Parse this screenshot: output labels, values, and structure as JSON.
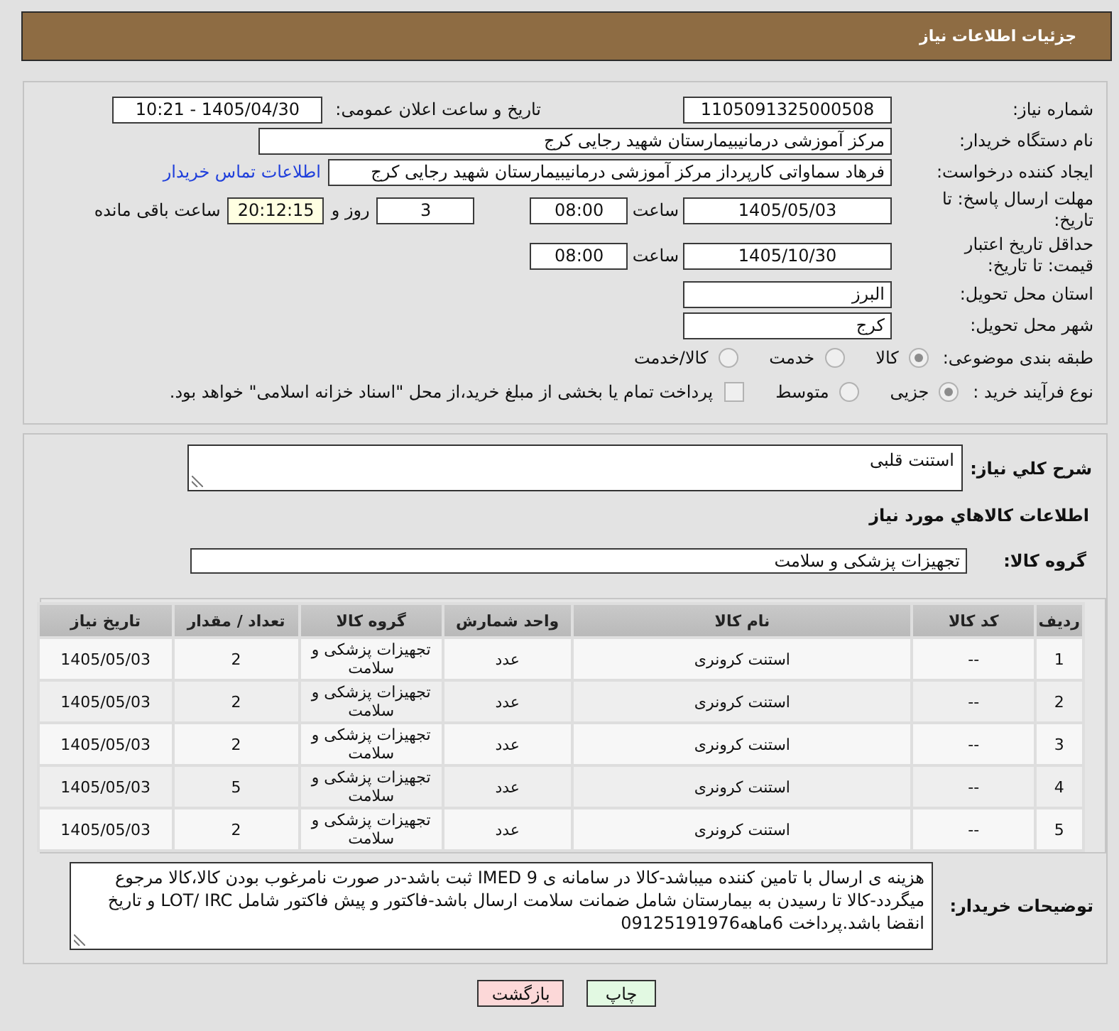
{
  "header": {
    "title": "جزئیات اطلاعات نیاز"
  },
  "form": {
    "need_number": {
      "label": "شماره نیاز:",
      "value": "1105091325000508"
    },
    "announce": {
      "label": "تاریخ و ساعت اعلان عمومی:",
      "value": "1405/04/30 - 10:21"
    },
    "buyer_org": {
      "label": "نام دستگاه خریدار:",
      "value": "مرکز آموزشی درمانیبیمارستان شهید رجایی کرج"
    },
    "requester": {
      "label": "ایجاد کننده درخواست:",
      "value": "فرهاد سماواتی کارپرداز مرکز آموزشی درمانیبیمارستان شهید رجایی کرج",
      "link": "اطلاعات تماس خریدار"
    },
    "reply_deadline": {
      "label": "مهلت ارسال پاسخ: تا تاریخ:",
      "date": "1405/05/03",
      "time_label": "ساعت",
      "time": "08:00",
      "days": "3",
      "days_label": "روز و",
      "remaining": "20:12:15",
      "remaining_label": "ساعت باقی مانده"
    },
    "price_validity": {
      "label": "حداقل تاریخ اعتبار قیمت: تا تاریخ:",
      "date": "1405/10/30",
      "time_label": "ساعت",
      "time": "08:00"
    },
    "province": {
      "label": "استان محل تحویل:",
      "value": "البرز"
    },
    "city": {
      "label": "شهر محل تحویل:",
      "value": "کرج"
    },
    "category": {
      "label": "طبقه بندی موضوعی:",
      "options": [
        {
          "label": "کالا",
          "selected": true
        },
        {
          "label": "خدمت",
          "selected": false
        },
        {
          "label": "کالا/خدمت",
          "selected": false
        }
      ]
    },
    "process": {
      "label": "نوع فرآیند خرید :",
      "options": [
        {
          "label": "جزیی",
          "selected": true
        },
        {
          "label": "متوسط",
          "selected": false
        }
      ],
      "treasury": {
        "label": "پرداخت تمام یا بخشی از مبلغ خرید،از محل \"اسناد خزانه اسلامی\" خواهد بود.",
        "checked": false
      }
    }
  },
  "need": {
    "description_label": "شرح کلي نياز:",
    "description": "استنت قلبی",
    "items_title": "اطلاعات كالاهاي مورد نياز",
    "group_label": "گروه کالا:",
    "group": "تجهیزات پزشکی و سلامت"
  },
  "table": {
    "columns": [
      "ردیف",
      "کد کالا",
      "نام کالا",
      "واحد شمارش",
      "گروه کالا",
      "تعداد / مقدار",
      "تاریخ نیاز"
    ],
    "rows": [
      [
        "1",
        "--",
        "استنت کرونری",
        "عدد",
        "تجهیزات پزشکی و سلامت",
        "2",
        "1405/05/03"
      ],
      [
        "2",
        "--",
        "استنت کرونری",
        "عدد",
        "تجهیزات پزشکی و سلامت",
        "2",
        "1405/05/03"
      ],
      [
        "3",
        "--",
        "استنت کرونری",
        "عدد",
        "تجهیزات پزشکی و سلامت",
        "2",
        "1405/05/03"
      ],
      [
        "4",
        "--",
        "استنت کرونری",
        "عدد",
        "تجهیزات پزشکی و سلامت",
        "5",
        "1405/05/03"
      ],
      [
        "5",
        "--",
        "استنت کرونری",
        "عدد",
        "تجهیزات پزشکی و سلامت",
        "2",
        "1405/05/03"
      ]
    ]
  },
  "notes": {
    "label": "توضیحات خریدار:",
    "value": "هزینه ی ارسال با تامین کننده میباشد-کالا در سامانه ی IMED 9 ثبت باشد-در صورت نامرغوب بودن کالا،کالا مرجوع میگردد-کالا تا رسیدن به بیمارستان شامل ضمانت سلامت ارسال باشد-فاکتور و پیش فاکتور شامل LOT/ IRC و تاریخ انقضا باشد.پرداخت 6ماهه09125191976"
  },
  "buttons": [
    {
      "label": "چاپ",
      "kind": "print"
    },
    {
      "label": "بازگشت",
      "kind": "back"
    }
  ]
}
